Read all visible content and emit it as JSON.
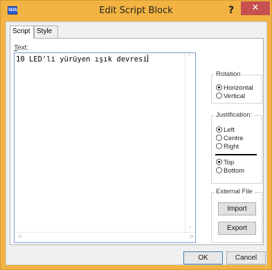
{
  "window": {
    "title": "Edit Script Block",
    "app_icon": "ISIS",
    "help": "?",
    "close": "✕"
  },
  "tabs": [
    {
      "label": "Script",
      "active": true
    },
    {
      "label": "Style",
      "active": false
    }
  ],
  "text": {
    "label_u": "T",
    "label_rest": "ext:",
    "value": "10 LED'li yürüyen ışık devresi"
  },
  "rotation": {
    "title": "Rotation",
    "options": [
      "Horizontal",
      "Vertical"
    ],
    "selected": "Horizontal"
  },
  "justification": {
    "title": "Justification:",
    "horizontal": [
      "Left",
      "Centre",
      "Right"
    ],
    "h_selected": "Left",
    "vertical": [
      "Top",
      "Bottom"
    ],
    "v_selected": "Top"
  },
  "external_file": {
    "title": "External File",
    "import": "Import",
    "export": "Export"
  },
  "footer": {
    "ok": "OK",
    "cancel": "Cancel"
  }
}
